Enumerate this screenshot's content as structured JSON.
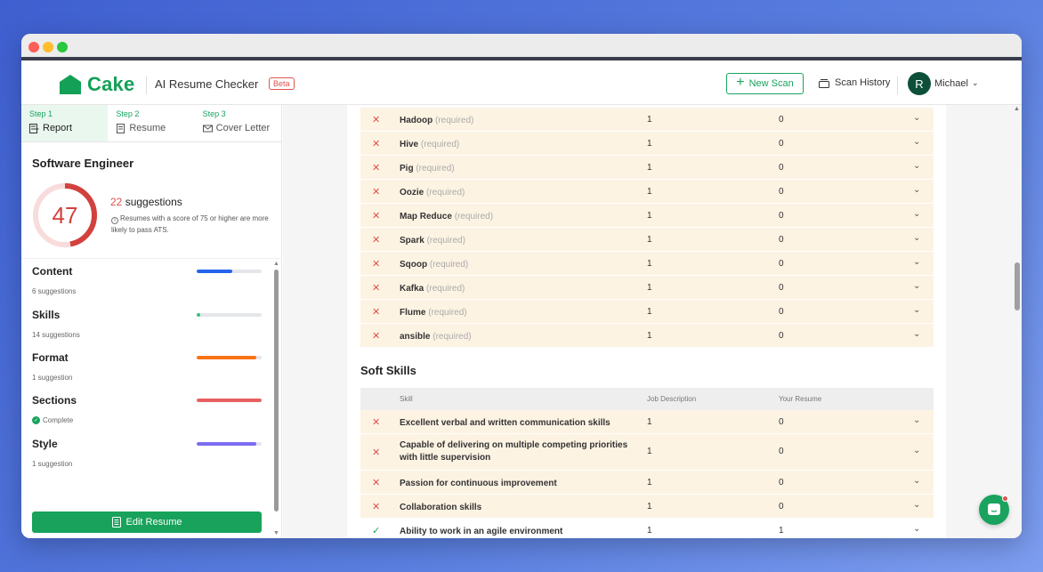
{
  "header": {
    "logo_text": "Cake",
    "app_title": "AI Resume Checker",
    "beta_label": "Beta",
    "new_scan_label": "New Scan",
    "scan_history_label": "Scan History",
    "user_initial": "R",
    "user_name": "Michael"
  },
  "steps": [
    {
      "num": "Step 1",
      "label": "Report",
      "icon": "report-icon",
      "active": true
    },
    {
      "num": "Step 2",
      "label": "Resume",
      "icon": "document-icon",
      "active": false
    },
    {
      "num": "Step 3",
      "label": "Cover Letter",
      "icon": "envelope-icon",
      "active": false
    }
  ],
  "report": {
    "job_title": "Software Engineer",
    "score": "47",
    "score_value": 47,
    "suggestions_count": "22",
    "suggestions_label": "suggestions",
    "ats_note": "Resumes with a score of 75 or higher are more likely to pass ATS."
  },
  "categories": [
    {
      "name": "Content",
      "sub": "6 suggestions",
      "fill": 0.55,
      "color": "#2563eb"
    },
    {
      "name": "Skills",
      "sub": "14 suggestions",
      "fill": 0.06,
      "color": "#34c47c"
    },
    {
      "name": "Format",
      "sub": "1 suggestion",
      "fill": 0.92,
      "color": "#f97316"
    },
    {
      "name": "Sections",
      "sub": "Complete",
      "fill": 1.0,
      "color": "#e86060"
    },
    {
      "name": "Style",
      "sub": "1 suggestion",
      "fill": 0.92,
      "color": "#7c6cf0"
    }
  ],
  "edit_resume_label": "Edit Resume",
  "hard_skills": [
    {
      "skill": "Hadoop",
      "note": "(required)",
      "jd": "1",
      "resume": "0"
    },
    {
      "skill": "Hive",
      "note": "(required)",
      "jd": "1",
      "resume": "0"
    },
    {
      "skill": "Pig",
      "note": "(required)",
      "jd": "1",
      "resume": "0"
    },
    {
      "skill": "Oozie",
      "note": "(required)",
      "jd": "1",
      "resume": "0"
    },
    {
      "skill": "Map Reduce",
      "note": "(required)",
      "jd": "1",
      "resume": "0"
    },
    {
      "skill": "Spark",
      "note": "(required)",
      "jd": "1",
      "resume": "0"
    },
    {
      "skill": "Sqoop",
      "note": "(required)",
      "jd": "1",
      "resume": "0"
    },
    {
      "skill": "Kafka",
      "note": "(required)",
      "jd": "1",
      "resume": "0"
    },
    {
      "skill": "Flume",
      "note": "(required)",
      "jd": "1",
      "resume": "0"
    },
    {
      "skill": "ansible",
      "note": "(required)",
      "jd": "1",
      "resume": "0"
    }
  ],
  "soft_skills": {
    "title": "Soft Skills",
    "columns": [
      "Skill",
      "Job Description",
      "Your Resume"
    ],
    "rows": [
      {
        "skill": "Excellent verbal and written communication skills",
        "jd": "1",
        "resume": "0",
        "matched": false
      },
      {
        "skill": "Capable of delivering on multiple competing priorities with little supervision",
        "jd": "1",
        "resume": "0",
        "matched": false
      },
      {
        "skill": "Passion for continuous improvement",
        "jd": "1",
        "resume": "0",
        "matched": false
      },
      {
        "skill": "Collaboration skills",
        "jd": "1",
        "resume": "0",
        "matched": false
      },
      {
        "skill": "Ability to work in an agile environment",
        "jd": "1",
        "resume": "1",
        "matched": true
      }
    ]
  },
  "colors": {
    "brand_green": "#19a35e",
    "missing_red": "#e0514f",
    "missing_row_bg": "#fdf3e3"
  }
}
